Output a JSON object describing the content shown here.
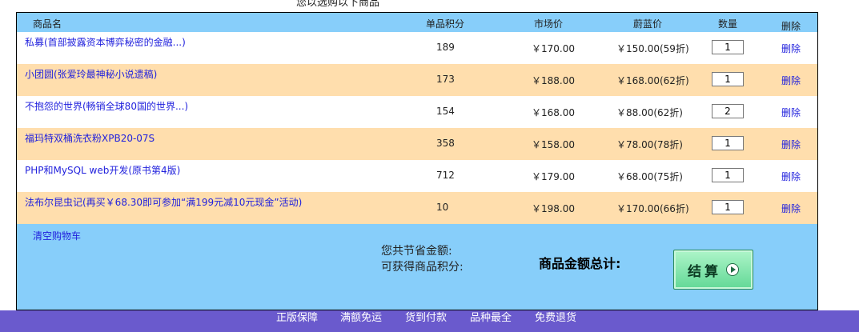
{
  "page_title": "您以选购以下商品",
  "columns": {
    "name": "商品名",
    "points": "单品积分",
    "market_price": "市场价",
    "price": "蔚蓝价",
    "quantity": "数量",
    "delete": "删除"
  },
  "items": [
    {
      "name": "私募(首部披露资本博弈秘密的金融...)",
      "points": "189",
      "market_price": "￥170.00",
      "price": "￥150.00(59折)",
      "quantity": "1",
      "delete": "删除"
    },
    {
      "name": "小团圆(张爱玲最神秘小说遗稿)",
      "points": "173",
      "market_price": "￥188.00",
      "price": "￥168.00(62折)",
      "quantity": "1",
      "delete": "删除"
    },
    {
      "name": "不抱怨的世界(畅销全球80国的世界...)",
      "points": "154",
      "market_price": "￥168.00",
      "price": "￥88.00(62折)",
      "quantity": "2",
      "delete": "删除"
    },
    {
      "name": "福玛特双桶洗衣粉XPB20-07S",
      "points": "358",
      "market_price": "￥158.00",
      "price": "￥78.00(78折)",
      "quantity": "1",
      "delete": "删除"
    },
    {
      "name": "PHP和MySQL web开发(原书第4版)",
      "points": "712",
      "market_price": "￥179.00",
      "price": "￥68.00(75折)",
      "quantity": "1",
      "delete": "删除"
    },
    {
      "name": "法布尔昆虫记(再买￥68.30即可参加“满199元减10元现金”活动)",
      "points": "10",
      "market_price": "￥198.00",
      "price": "￥170.00(66折)",
      "quantity": "1",
      "delete": "删除"
    }
  ],
  "clear_cart": "清空购物车",
  "summary": {
    "saved_label": "您共节省金额:",
    "points_label": "可获得商品积分:",
    "total_label": "商品金额总计:"
  },
  "checkout": {
    "label": "结算",
    "icon": "play-icon"
  },
  "footer": [
    "正版保障",
    "满额免运",
    "货到付款",
    "品种最全",
    "免费退货"
  ],
  "colors": {
    "header_bg": "#87cefa",
    "row_alt": "#ffdead",
    "footer_bg": "#6a5acd",
    "link": "#2222dd"
  }
}
